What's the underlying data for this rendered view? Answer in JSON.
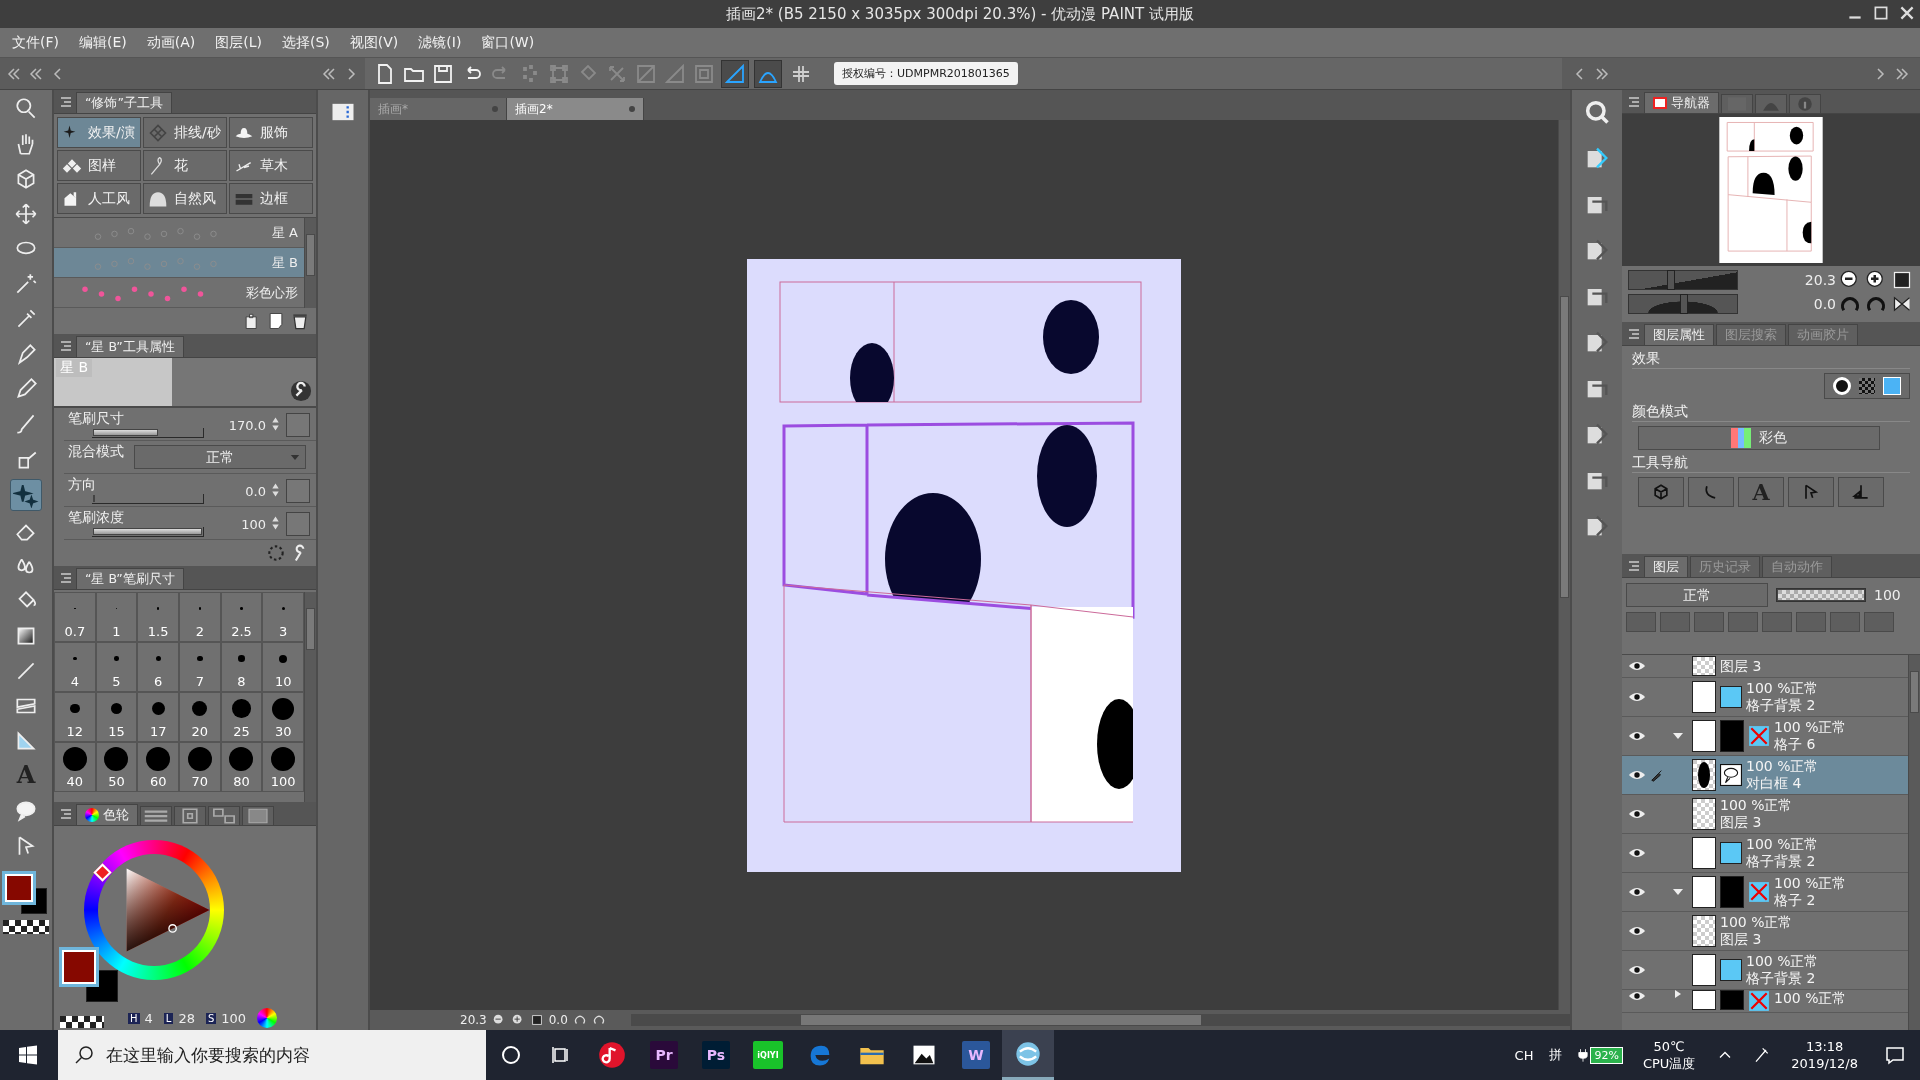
{
  "window": {
    "title": "插画2* (B5 2150 x 3035px 300dpi 20.3%) - 优动漫 PAINT 试用版"
  },
  "menu": [
    "文件(F)",
    "编辑(E)",
    "动画(A)",
    "图层(L)",
    "选择(S)",
    "视图(V)",
    "滤镜(I)",
    "窗口(W)"
  ],
  "toolbar": {
    "buttons": [
      {
        "kind": "new",
        "disabled": false
      },
      {
        "kind": "open",
        "disabled": false
      },
      {
        "kind": "save",
        "disabled": false
      },
      {
        "kind": "undo",
        "disabled": false
      },
      {
        "kind": "redo",
        "disabled": true
      },
      {
        "kind": "scatter",
        "disabled": true
      },
      {
        "kind": "transform",
        "disabled": true
      },
      {
        "kind": "fill",
        "disabled": true
      },
      {
        "kind": "scale",
        "disabled": true
      },
      {
        "kind": "clear",
        "disabled": true
      },
      {
        "kind": "crop",
        "disabled": true
      },
      {
        "kind": "select",
        "disabled": true
      }
    ],
    "snap_toggles": [
      {
        "on": true
      },
      {
        "on": true
      },
      {
        "on": false
      }
    ],
    "license_label": "授权编号：UDMPMR201801365"
  },
  "doc_tabs": [
    {
      "label": "插画*",
      "selected": false
    },
    {
      "label": "插画2*",
      "selected": true
    }
  ],
  "tools": [
    {
      "kind": "zoom",
      "selected": false
    },
    {
      "kind": "hand",
      "selected": false
    },
    {
      "kind": "object",
      "selected": false
    },
    {
      "kind": "move",
      "selected": false
    },
    {
      "kind": "lasso",
      "selected": false
    },
    {
      "kind": "wand",
      "selected": false
    },
    {
      "kind": "eyedropper",
      "selected": false
    },
    {
      "kind": "pen",
      "selected": false
    },
    {
      "kind": "pencil",
      "selected": false
    },
    {
      "kind": "brush",
      "selected": false
    },
    {
      "kind": "airbrush",
      "selected": false
    },
    {
      "kind": "decoration",
      "selected": true
    },
    {
      "kind": "eraser",
      "selected": false
    },
    {
      "kind": "blend",
      "selected": false
    },
    {
      "kind": "fill",
      "selected": false
    },
    {
      "kind": "gradient",
      "selected": false
    },
    {
      "kind": "line",
      "selected": false
    },
    {
      "kind": "frame",
      "selected": false
    },
    {
      "kind": "ruler",
      "selected": false
    },
    {
      "kind": "text",
      "glyph": "A",
      "selected": false
    },
    {
      "kind": "balloon",
      "selected": false
    },
    {
      "kind": "correct",
      "selected": false
    }
  ],
  "tool_swatches": [
    {
      "color": "#860800",
      "selected": true
    },
    {
      "color": "#000000",
      "selected": false
    }
  ],
  "subtool_panel": {
    "title": "“修饰”子工具",
    "groups": [
      {
        "kind": "sparkle",
        "label": "效果/演",
        "selected": true
      },
      {
        "kind": "hatch",
        "label": "排线/砂",
        "selected": false
      },
      {
        "kind": "hat",
        "label": "服饰",
        "selected": false
      },
      {
        "kind": "pattern",
        "label": "图样",
        "selected": false
      },
      {
        "kind": "flower",
        "label": "花",
        "selected": false
      },
      {
        "kind": "grass",
        "label": "草木",
        "selected": false
      },
      {
        "kind": "house",
        "label": "人工风",
        "selected": false
      },
      {
        "kind": "rock",
        "label": "自然风",
        "selected": false
      },
      {
        "kind": "border",
        "label": "边框",
        "selected": false
      }
    ],
    "brushes": [
      {
        "kind": "stars",
        "label": "星 A",
        "selected": false
      },
      {
        "kind": "stars",
        "label": "星 B",
        "selected": true
      },
      {
        "kind": "hearts",
        "label": "彩色心形",
        "selected": false
      }
    ]
  },
  "tool_property": {
    "title": "“星 B”工具属性",
    "preview_label": "星 B",
    "rows": [
      {
        "kind": "slider",
        "label": "笔刷尺寸",
        "value": "170.0",
        "level": 0.6
      },
      {
        "kind": "dropdown",
        "label": "混合模式",
        "value": "正常"
      },
      {
        "kind": "slider",
        "label": "方向",
        "value": "0.0",
        "level": 0
      },
      {
        "kind": "slider",
        "label": "笔刷浓度",
        "value": "100",
        "level": 1
      }
    ]
  },
  "brush_size": {
    "title": "“星 B”笔刷尺寸",
    "sizes": [
      "0.7",
      "1",
      "1.5",
      "2",
      "2.5",
      "3",
      "4",
      "5",
      "6",
      "7",
      "8",
      "10",
      "12",
      "15",
      "17",
      "20",
      "25",
      "30",
      "40",
      "50",
      "60",
      "70",
      "80",
      "100"
    ]
  },
  "color_panel": {
    "tab": "色轮",
    "swatches": [
      {
        "color": "#860800",
        "selected": true
      },
      {
        "color": "#000000",
        "selected": false
      }
    ],
    "readouts": [
      {
        "key": "H",
        "value": "4"
      },
      {
        "key": "L",
        "value": "28"
      },
      {
        "key": "S",
        "value": "100"
      }
    ]
  },
  "canvas": {
    "zoom": "20.3",
    "angle": "0.0"
  },
  "navigator": {
    "tabs": [
      {
        "kind": "navigator",
        "label": "导航器",
        "selected": true
      },
      {
        "kind": "subview",
        "selected": false
      },
      {
        "kind": "material",
        "selected": false
      },
      {
        "kind": "info",
        "selected": false
      }
    ],
    "zoom": "20.3",
    "angle": "0.0",
    "zoom_slider": {
      "level": 0.38
    },
    "rotation_slider": {
      "level": 0.5
    }
  },
  "layer_property": {
    "tabs": [
      {
        "label": "图层属性",
        "selected": true
      },
      {
        "label": "图层搜索",
        "selected": false
      },
      {
        "label": "动画胶片",
        "selected": false
      }
    ],
    "effect_label": "效果",
    "color_mode_label": "颜色模式",
    "color_mode": "彩色",
    "tool_nav_label": "工具导航",
    "tool_nav": [
      {
        "kind": "object"
      },
      {
        "kind": "curve"
      },
      {
        "kind": "text",
        "glyph": "A"
      },
      {
        "kind": "correct"
      },
      {
        "kind": "flip"
      }
    ]
  },
  "layers": {
    "tabs": [
      {
        "label": "图层",
        "selected": true
      },
      {
        "label": "历史记录",
        "selected": false
      },
      {
        "label": "自动动作",
        "selected": false
      }
    ],
    "blend_mode": "正常",
    "opacity": "100",
    "opacity_slider": {
      "level": 1
    },
    "items": [
      {
        "kind": "raster",
        "name": "图层 3",
        "selected": false
      },
      {
        "kind": "frame_bg",
        "mode": "100 %正常",
        "name": "格子背景 2",
        "selected": false
      },
      {
        "kind": "folder",
        "mode": "100 %正常",
        "name": "格子 6",
        "selected": false,
        "expanded": true,
        "children": [
          {
            "kind": "balloon",
            "mode": "100 %正常",
            "name": "对白框 4",
            "selected": true
          },
          {
            "kind": "raster",
            "mode": "100 %正常",
            "name": "图层 3",
            "selected": false
          },
          {
            "kind": "frame_bg",
            "mode": "100 %正常",
            "name": "格子背景 2",
            "selected": false
          }
        ]
      },
      {
        "kind": "folder",
        "mode": "100 %正常",
        "name": "格子 2",
        "selected": false,
        "expanded": true,
        "children": [
          {
            "kind": "raster",
            "mode": "100 %正常",
            "name": "图层 3",
            "selected": false
          },
          {
            "kind": "frame_bg",
            "mode": "100 %正常",
            "name": "格子背景 2",
            "selected": false
          }
        ]
      },
      {
        "kind": "folder",
        "mode": "100 %正常",
        "selected": false,
        "expanded": false
      }
    ]
  },
  "taskbar": {
    "search_placeholder": "在这里输入你要搜索的内容",
    "apps": [
      {
        "kind": "music",
        "selected": false
      },
      {
        "kind": "premiere",
        "label": "Pr",
        "selected": false
      },
      {
        "kind": "photoshop",
        "label": "Ps",
        "selected": false
      },
      {
        "kind": "video",
        "label": "iQIYI",
        "selected": false
      },
      {
        "kind": "edge",
        "selected": false
      },
      {
        "kind": "explorer",
        "selected": false
      },
      {
        "kind": "photos",
        "selected": false
      },
      {
        "kind": "word",
        "label": "W",
        "selected": false
      },
      {
        "kind": "paint",
        "selected": true
      }
    ],
    "ime": "CH",
    "ime_mode": "拼",
    "battery": "92%",
    "temperature": "50℃",
    "temperature_label": "CPU温度",
    "time": "13:18",
    "date": "2019/12/8"
  }
}
